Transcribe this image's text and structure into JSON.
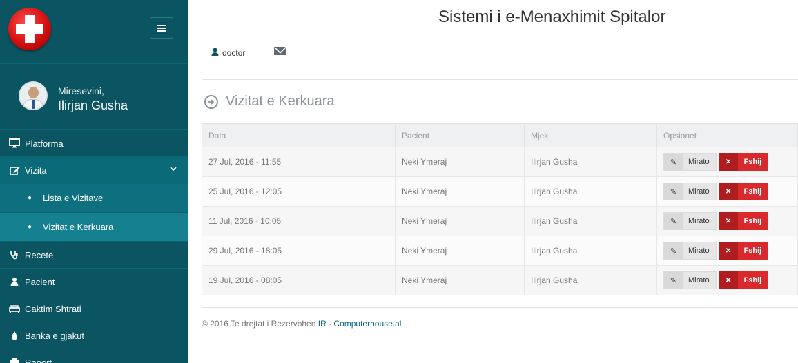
{
  "app": {
    "title": "Sistemi i e-Menaxhimit Spitalor"
  },
  "sidebar": {
    "welcome": "Miresevini,",
    "user_name": "Ilirjan Gusha",
    "items": [
      {
        "label": "Platforma",
        "icon": "monitor-icon"
      },
      {
        "label": "Vizita",
        "icon": "edit-icon",
        "expanded": true,
        "sub": [
          {
            "label": "Lista e Vizitave"
          },
          {
            "label": "Vizitat e Kerkuara",
            "active": true
          }
        ]
      },
      {
        "label": "Recete",
        "icon": "stethoscope-icon"
      },
      {
        "label": "Pacient",
        "icon": "user-icon"
      },
      {
        "label": "Caktim Shtrati",
        "icon": "bed-icon"
      },
      {
        "label": "Banka e gjakut",
        "icon": "drop-icon"
      },
      {
        "label": "Raport",
        "icon": "report-icon"
      }
    ]
  },
  "header": {
    "user_label": "doctor"
  },
  "page": {
    "heading": "Vizitat e Kerkuara"
  },
  "table": {
    "headers": [
      "Data",
      "Pacient",
      "Mjek",
      "Opsionet"
    ],
    "approve_label": "Mirato",
    "delete_label": "Fshij",
    "rows": [
      {
        "data": "27 Jul, 2016 - 11:55",
        "pacient": "Neki Ymeraj",
        "mjek": "Ilirjan Gusha"
      },
      {
        "data": "25 Jul, 2016 - 12:05",
        "pacient": "Neki Ymeraj",
        "mjek": "Ilirjan Gusha"
      },
      {
        "data": "11 Jul, 2016 - 10:05",
        "pacient": "Neki Ymeraj",
        "mjek": "Ilirjan Gusha"
      },
      {
        "data": "29 Jul, 2016 - 18:05",
        "pacient": "Neki Ymeraj",
        "mjek": "Ilirjan Gusha"
      },
      {
        "data": "19 Jul, 2016 - 08:05",
        "pacient": "Neki Ymeraj",
        "mjek": "Ilirjan Gusha"
      }
    ]
  },
  "footer": {
    "copyright": "© 2016 Te drejtat i Rezervohen",
    "link_ir": "IR",
    "separator": " - ",
    "link_site": "Computerhouse.al"
  },
  "colors": {
    "sidebar": "#0b5563",
    "accent": "#15808f",
    "danger": "#d9292c"
  }
}
